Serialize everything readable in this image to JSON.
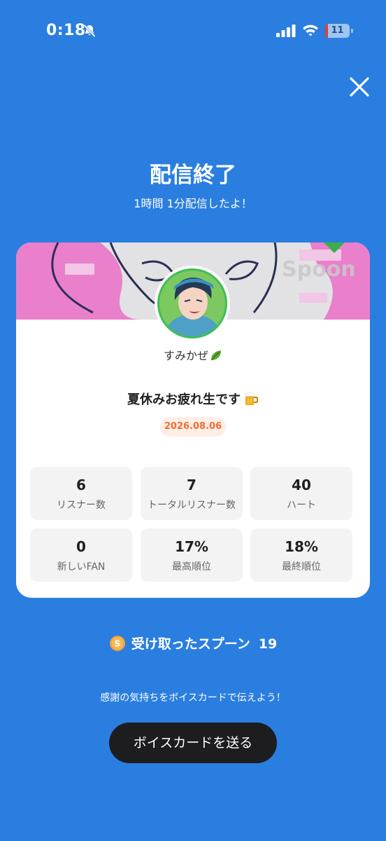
{
  "status_bar": {
    "time": "0:18",
    "battery_level": "11",
    "battery_percent": 11,
    "icons": [
      "bell-slash-icon",
      "cellular-signal-icon",
      "wifi-icon",
      "battery-icon"
    ]
  },
  "header": {
    "close_icon": "close-icon",
    "title": "配信終了",
    "subtitle": "1時間 1分配信したよ！"
  },
  "card": {
    "banner_watermark": "Spoon",
    "username": "すみかぜ",
    "username_icon": "leaf-icon",
    "stream_title": "夏休みお疲れ生です",
    "stream_title_icon": "beer-mug-icon",
    "date": "2026.08.06",
    "stats": [
      {
        "value": "6",
        "label": "リスナー数"
      },
      {
        "value": "7",
        "label": "トータルリスナー数"
      },
      {
        "value": "40",
        "label": "ハート"
      },
      {
        "value": "0",
        "label": "新しいFAN"
      },
      {
        "value": "17%",
        "label": "最高順位"
      },
      {
        "value": "18%",
        "label": "最終順位"
      }
    ]
  },
  "spoons": {
    "icon": "spoon-coin-icon",
    "label": "受け取ったスプーン",
    "count": "19"
  },
  "footer": {
    "message": "感謝の気持ちをボイスカードで伝えよう！",
    "button_label": "ボイスカードを送る"
  },
  "colors": {
    "background": "#2a7ee0",
    "card": "#ffffff",
    "stat_box": "#f3f3f3",
    "date_badge_bg": "#fdeee6",
    "date_badge_text": "#f16c2f",
    "button_bg": "#1d1d1f"
  }
}
